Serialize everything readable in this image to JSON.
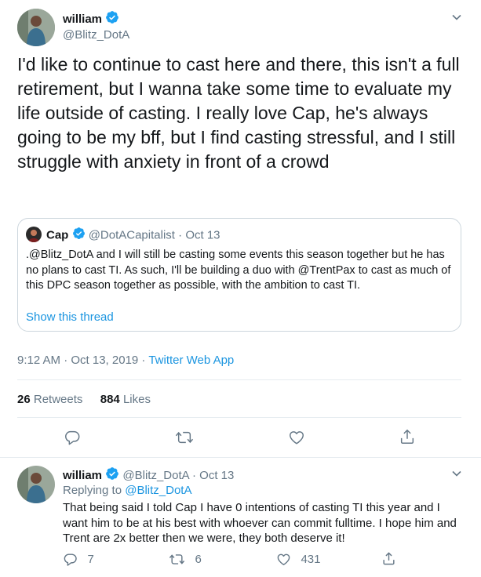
{
  "tweet": {
    "author_name": "william",
    "handle": "@Blitz_DotA",
    "body": "I'd like to continue to cast here and there, this isn't a full retirement, but I wanna take some time to evaluate my life outside of casting. I really love Cap, he's always going to be my bff, but I find casting stressful, and I still struggle with anxiety in front of a crowd",
    "quote": {
      "author_name": "Cap",
      "handle": "@DotACapitalist",
      "date": "Oct 13",
      "separator": "·",
      "body": ".@Blitz_DotA and I will still be casting some events this season together but he has no plans to cast TI. As such, I'll be building a duo with @TrentPax to cast as much of this DPC season together as possible, with the ambition to cast TI.",
      "show_thread": "Show this thread"
    },
    "time": "9:12 AM · Oct 13, 2019 · ",
    "source": "Twitter Web App",
    "retweets_count": "26",
    "retweets_label": "Retweets",
    "likes_count": "884",
    "likes_label": "Likes"
  },
  "reply": {
    "author_name": "william",
    "handle": "@Blitz_DotA",
    "date": "· Oct 13",
    "replying_prefix": "Replying to ",
    "replying_to": "@Blitz_DotA",
    "body": "That being said I told Cap I have 0 intentions of casting TI this year and I want him to be at his best with whoever can commit fulltime. I hope him and Trent are 2x better then we were, they both deserve it!",
    "reply_count": "7",
    "retweet_count": "6",
    "like_count": "431"
  },
  "colors": {
    "accent": "#1da1f2",
    "muted": "#657786",
    "divider": "#e6ecf0"
  },
  "icons": [
    "chevron-down-icon",
    "verified-badge-icon",
    "reply-icon",
    "retweet-icon",
    "like-icon",
    "share-icon"
  ]
}
